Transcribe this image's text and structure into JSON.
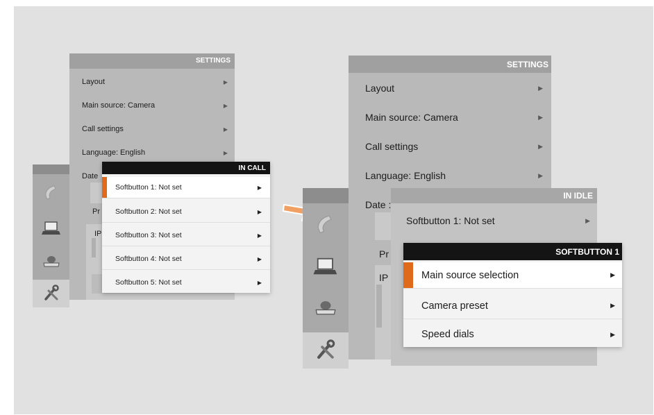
{
  "colors": {
    "background": "#e1e1e1",
    "accent_orange": "#e06a1c",
    "header_dark": "#141414",
    "header_grey": "#a0a0a0"
  },
  "left": {
    "settings": {
      "title": "SETTINGS",
      "items": [
        {
          "label": "Layout"
        },
        {
          "label": "Main source: Camera"
        },
        {
          "label": "Call settings"
        },
        {
          "label": "Language: English"
        }
      ],
      "partial_date": "Date",
      "partial_pr": "Pr",
      "partial_ip": "IP"
    },
    "popup": {
      "title": "IN CALL",
      "selected_index": 0,
      "items": [
        {
          "label": "Softbutton 1: Not set"
        },
        {
          "label": "Softbutton 2: Not set"
        },
        {
          "label": "Softbutton 3: Not set"
        },
        {
          "label": "Softbutton 4: Not set"
        },
        {
          "label": "Softbutton 5: Not set"
        }
      ]
    },
    "sidebar_icons": [
      "phone-icon",
      "laptop-icon",
      "video-camera-icon",
      "tools-icon"
    ]
  },
  "right": {
    "settings": {
      "title": "SETTINGS",
      "items": [
        {
          "label": "Layout"
        },
        {
          "label": "Main source: Camera"
        },
        {
          "label": "Call settings"
        },
        {
          "label": "Language: English"
        }
      ],
      "partial_date": "Date :",
      "partial_pr": "Pr",
      "partial_ip": "IP"
    },
    "idle_popup": {
      "title": "IN IDLE",
      "items": [
        {
          "label": "Softbutton 1: Not set"
        }
      ]
    },
    "popup": {
      "title": "SOFTBUTTON 1",
      "selected_index": 0,
      "items": [
        {
          "label": "Main source selection"
        },
        {
          "label": "Camera preset"
        },
        {
          "label": "Speed dials"
        }
      ]
    },
    "sidebar_icons": [
      "phone-icon",
      "laptop-icon",
      "video-camera-icon",
      "tools-icon"
    ]
  },
  "arrow_icon": "arrow-right-icon"
}
